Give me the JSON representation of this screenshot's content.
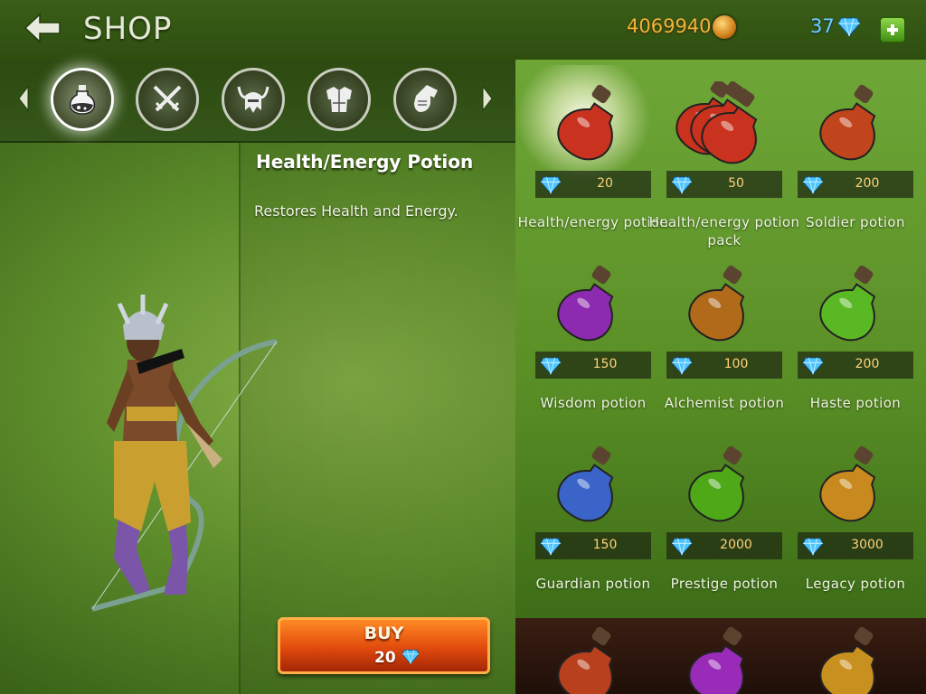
{
  "header": {
    "title": "SHOP",
    "gold": "4069940",
    "gems": "37"
  },
  "categories": [
    {
      "name": "potions",
      "icon": "potion-icon",
      "active": true
    },
    {
      "name": "weapons",
      "icon": "crossed-swords-icon",
      "active": false
    },
    {
      "name": "helmets",
      "icon": "horned-helmet-icon",
      "active": false
    },
    {
      "name": "armor",
      "icon": "chest-armor-icon",
      "active": false
    },
    {
      "name": "gloves",
      "icon": "gauntlet-icon",
      "active": false
    }
  ],
  "detail": {
    "name": "Health/Energy Potion",
    "description": "Restores Health and Energy.",
    "buy_label": "BUY",
    "buy_price": "20"
  },
  "items": [
    {
      "name": "Health/energy potion",
      "price": "20",
      "color": "#c8321e"
    },
    {
      "name": "Health/energy potion pack",
      "price": "50",
      "color": "#c8321e"
    },
    {
      "name": "Soldier potion",
      "price": "200",
      "color": "#c0441c"
    },
    {
      "name": "Wisdom potion",
      "price": "150",
      "color": "#8c2ab0"
    },
    {
      "name": "Alchemist potion",
      "price": "100",
      "color": "#b06a1a"
    },
    {
      "name": "Haste potion",
      "price": "200",
      "color": "#5ab824"
    },
    {
      "name": "Guardian potion",
      "price": "150",
      "color": "#3a64c8"
    },
    {
      "name": "Prestige potion",
      "price": "2000",
      "color": "#4ea818"
    },
    {
      "name": "Legacy potion",
      "price": "3000",
      "color": "#c88a1e"
    }
  ],
  "bottom_row_colors": [
    "#b8401c",
    "#9a2ab8",
    "#c8901e"
  ]
}
